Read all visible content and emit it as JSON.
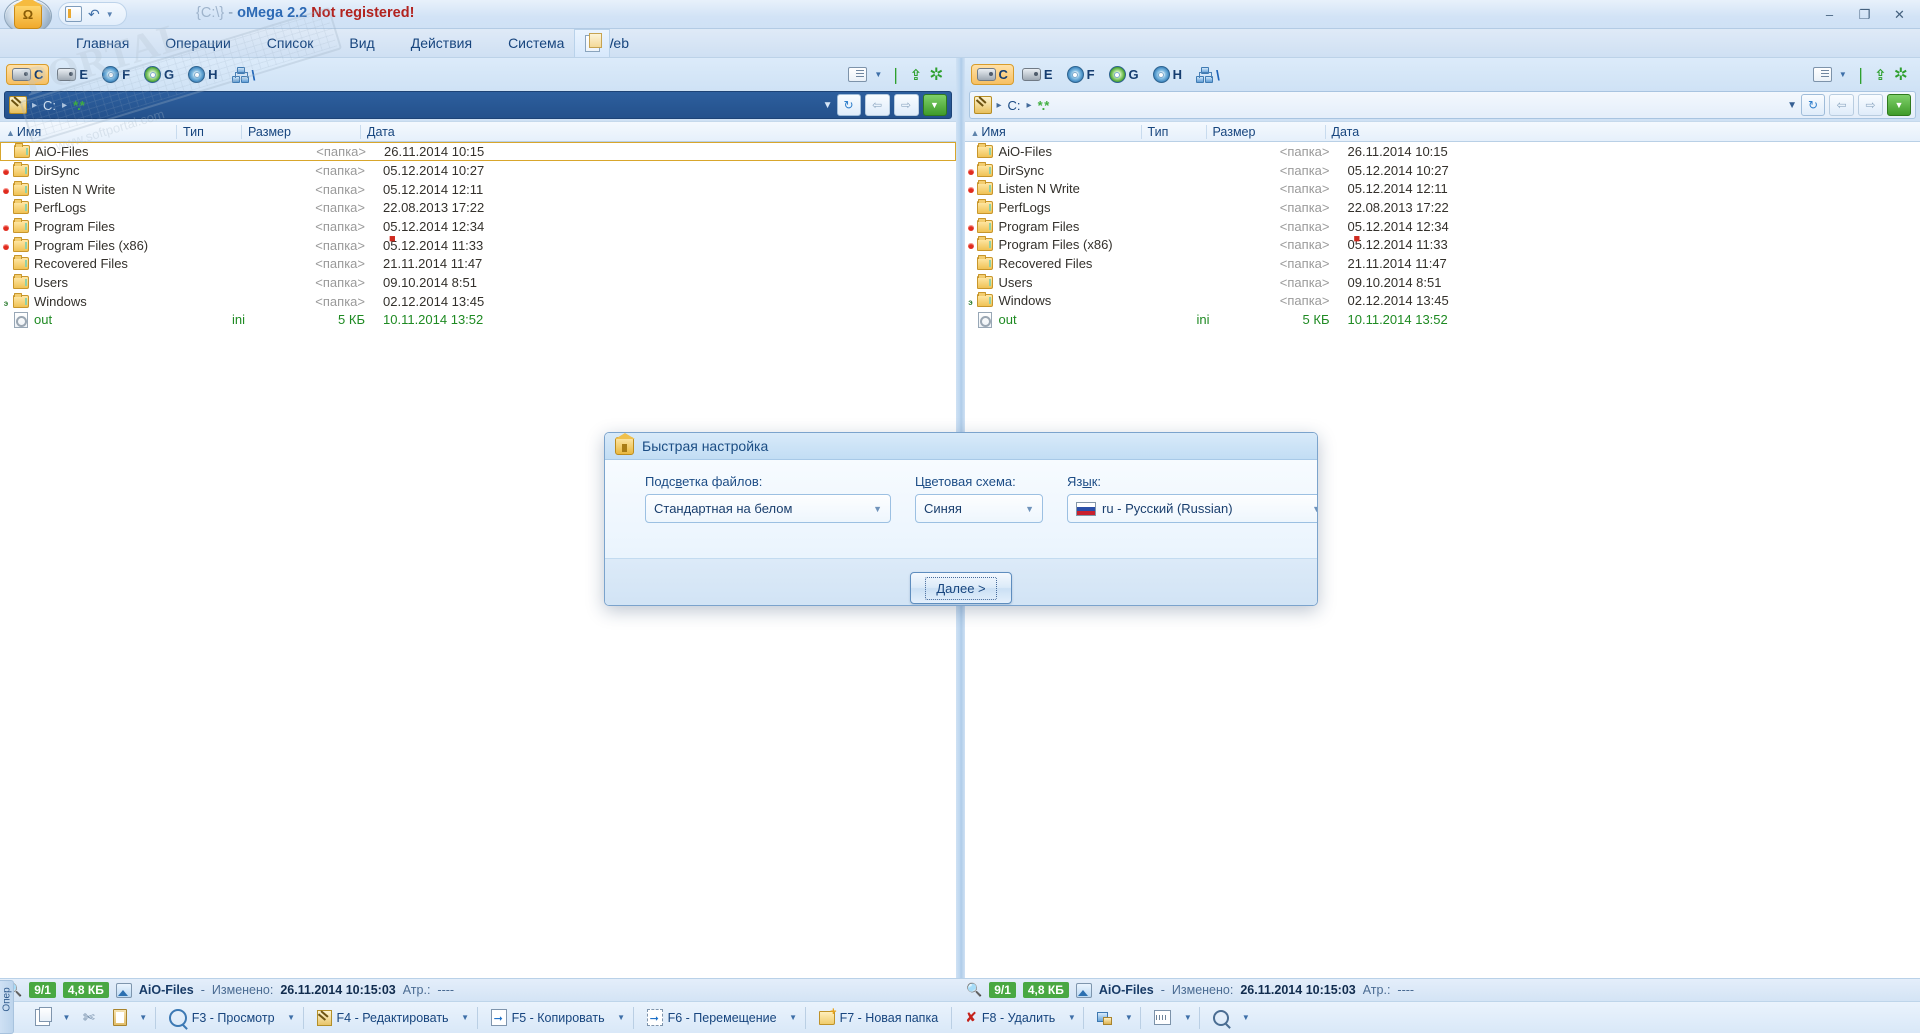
{
  "window": {
    "title_path": "{C:\\}",
    "title_dash": "-",
    "app_name": "oMega 2.2",
    "title_warning": "Not registered!",
    "minimize": "–",
    "restore": "❐",
    "close": "✕"
  },
  "menu": {
    "items": [
      {
        "label": "Главная"
      },
      {
        "label": "Операции"
      },
      {
        "label": "Список"
      },
      {
        "label": "Вид"
      },
      {
        "label": "Действия"
      },
      {
        "label": "Система"
      },
      {
        "label": "Web"
      }
    ]
  },
  "drives": [
    {
      "letter": "C",
      "icon": "hdd-icon",
      "active": true
    },
    {
      "letter": "E",
      "icon": "hdd-icon",
      "active": false
    },
    {
      "letter": "F",
      "icon": "cd-icon",
      "active": false
    },
    {
      "letter": "G",
      "icon": "cd-green-icon",
      "active": false
    },
    {
      "letter": "H",
      "icon": "cd-icon",
      "active": false
    },
    {
      "letter": "\\",
      "icon": "network-icon",
      "active": false
    }
  ],
  "left_panel": {
    "address": {
      "drive": "C:",
      "mask": "*.*",
      "sep": "▸"
    },
    "columns": [
      {
        "label": "Имя"
      },
      {
        "label": "Тип"
      },
      {
        "label": "Размер"
      },
      {
        "label": "Дата"
      }
    ],
    "rows": [
      {
        "name": "AiO-Files",
        "type": "",
        "size": "<папка>",
        "date": "26.11.2014 10:15",
        "kind": "folder",
        "marked": false,
        "selected": true,
        "badge": ""
      },
      {
        "name": "DirSync",
        "type": "",
        "size": "<папка>",
        "date": "05.12.2014 10:27",
        "kind": "folder",
        "marked": true,
        "selected": false,
        "badge": ""
      },
      {
        "name": "Listen N Write",
        "type": "",
        "size": "<папка>",
        "date": "05.12.2014 12:11",
        "kind": "folder",
        "marked": true,
        "selected": false,
        "badge": ""
      },
      {
        "name": "PerfLogs",
        "type": "",
        "size": "<папка>",
        "date": "22.08.2013 17:22",
        "kind": "folder",
        "marked": false,
        "selected": false,
        "badge": ""
      },
      {
        "name": "Program Files",
        "type": "",
        "size": "<папка>",
        "date": "05.12.2014 12:34",
        "kind": "folder",
        "marked": true,
        "selected": false,
        "badge": ""
      },
      {
        "name": "Program Files (x86)",
        "type": "",
        "size": "<папка>",
        "date": "05.12.2014 11:33",
        "kind": "folder",
        "marked": true,
        "selected": false,
        "badge": ""
      },
      {
        "name": "Recovered Files",
        "type": "",
        "size": "<папка>",
        "date": "21.11.2014 11:47",
        "kind": "folder",
        "marked": false,
        "selected": false,
        "badge": ""
      },
      {
        "name": "Users",
        "type": "",
        "size": "<папка>",
        "date": "09.10.2014 8:51",
        "kind": "folder",
        "marked": false,
        "selected": false,
        "badge": ""
      },
      {
        "name": "Windows",
        "type": "",
        "size": "<папка>",
        "date": "02.12.2014 13:45",
        "kind": "folder",
        "marked": false,
        "selected": false,
        "badge": "э"
      },
      {
        "name": "out",
        "type": "ini",
        "size": "5 КБ",
        "date": "10.11.2014 13:52",
        "kind": "file",
        "marked": false,
        "selected": false,
        "badge": ""
      }
    ],
    "status": {
      "counts": "9/1",
      "size": "4,8 КБ",
      "name": "AiO-Files",
      "dash": "-",
      "changed_label": "Изменено:",
      "changed_value": "26.11.2014 10:15:03",
      "attr_label": "Атр.:",
      "attr_value": "----"
    }
  },
  "right_panel": {
    "address": {
      "drive": "C:",
      "mask": "*.*",
      "sep": "▸"
    },
    "columns": [
      {
        "label": "Имя"
      },
      {
        "label": "Тип"
      },
      {
        "label": "Размер"
      },
      {
        "label": "Дата"
      }
    ],
    "rows": [
      {
        "name": "AiO-Files",
        "type": "",
        "size": "<папка>",
        "date": "26.11.2014 10:15",
        "kind": "folder",
        "marked": false,
        "selected": false,
        "badge": ""
      },
      {
        "name": "DirSync",
        "type": "",
        "size": "<папка>",
        "date": "05.12.2014 10:27",
        "kind": "folder",
        "marked": true,
        "selected": false,
        "badge": ""
      },
      {
        "name": "Listen N Write",
        "type": "",
        "size": "<папка>",
        "date": "05.12.2014 12:11",
        "kind": "folder",
        "marked": true,
        "selected": false,
        "badge": ""
      },
      {
        "name": "PerfLogs",
        "type": "",
        "size": "<папка>",
        "date": "22.08.2013 17:22",
        "kind": "folder",
        "marked": false,
        "selected": false,
        "badge": ""
      },
      {
        "name": "Program Files",
        "type": "",
        "size": "<папка>",
        "date": "05.12.2014 12:34",
        "kind": "folder",
        "marked": true,
        "selected": false,
        "badge": ""
      },
      {
        "name": "Program Files (x86)",
        "type": "",
        "size": "<папка>",
        "date": "05.12.2014 11:33",
        "kind": "folder",
        "marked": true,
        "selected": false,
        "badge": ""
      },
      {
        "name": "Recovered Files",
        "type": "",
        "size": "<папка>",
        "date": "21.11.2014 11:47",
        "kind": "folder",
        "marked": false,
        "selected": false,
        "badge": ""
      },
      {
        "name": "Users",
        "type": "",
        "size": "<папка>",
        "date": "09.10.2014 8:51",
        "kind": "folder",
        "marked": false,
        "selected": false,
        "badge": ""
      },
      {
        "name": "Windows",
        "type": "",
        "size": "<папка>",
        "date": "02.12.2014 13:45",
        "kind": "folder",
        "marked": false,
        "selected": false,
        "badge": "э"
      },
      {
        "name": "out",
        "type": "ini",
        "size": "5 КБ",
        "date": "10.11.2014 13:52",
        "kind": "file",
        "marked": false,
        "selected": false,
        "badge": ""
      }
    ],
    "status": {
      "counts": "9/1",
      "size": "4,8 КБ",
      "name": "AiO-Files",
      "dash": "-",
      "changed_label": "Изменено:",
      "changed_value": "26.11.2014 10:15:03",
      "attr_label": "Атр.:",
      "attr_value": "----"
    }
  },
  "function_bar": {
    "vertical_tab": "Опер",
    "buttons": [
      {
        "label": "F3 - Просмотр",
        "icon": "view-icon",
        "dropdown": true
      },
      {
        "label": "F4 - Редактировать",
        "icon": "edit-icon",
        "dropdown": true
      },
      {
        "label": "F5 - Копировать",
        "icon": "copy-icon",
        "dropdown": true
      },
      {
        "label": "F6 - Перемещение",
        "icon": "move-icon",
        "dropdown": true
      },
      {
        "label": "F7 - Новая папка",
        "icon": "new-folder-icon",
        "dropdown": false
      },
      {
        "label": "F8 - Удалить",
        "icon": "delete-icon",
        "dropdown": true
      }
    ]
  },
  "dialog": {
    "title": "Быстрая настройка",
    "fields": [
      {
        "label_pre": "Подс",
        "label_accel": "в",
        "label_post": "етка файлов:",
        "value": "Стандартная на белом"
      },
      {
        "label_pre": "Ц",
        "label_accel": "в",
        "label_post": "етовая схема:",
        "value": "Синяя"
      },
      {
        "label_pre": "Яз",
        "label_accel": "ы",
        "label_post": "к:",
        "value": "ru - Русский (Russian)"
      }
    ],
    "next_button": "Далее >"
  },
  "watermark": {
    "text": "PORTAL",
    "sub": "www.softportal.com"
  },
  "colors": {
    "accent": "#1b4d84",
    "selection": "#d8a62c",
    "folder": "#f0c255",
    "file_green": "#1e8a22",
    "warning": "#b2231f",
    "address_focus": "#2d5f9e"
  }
}
